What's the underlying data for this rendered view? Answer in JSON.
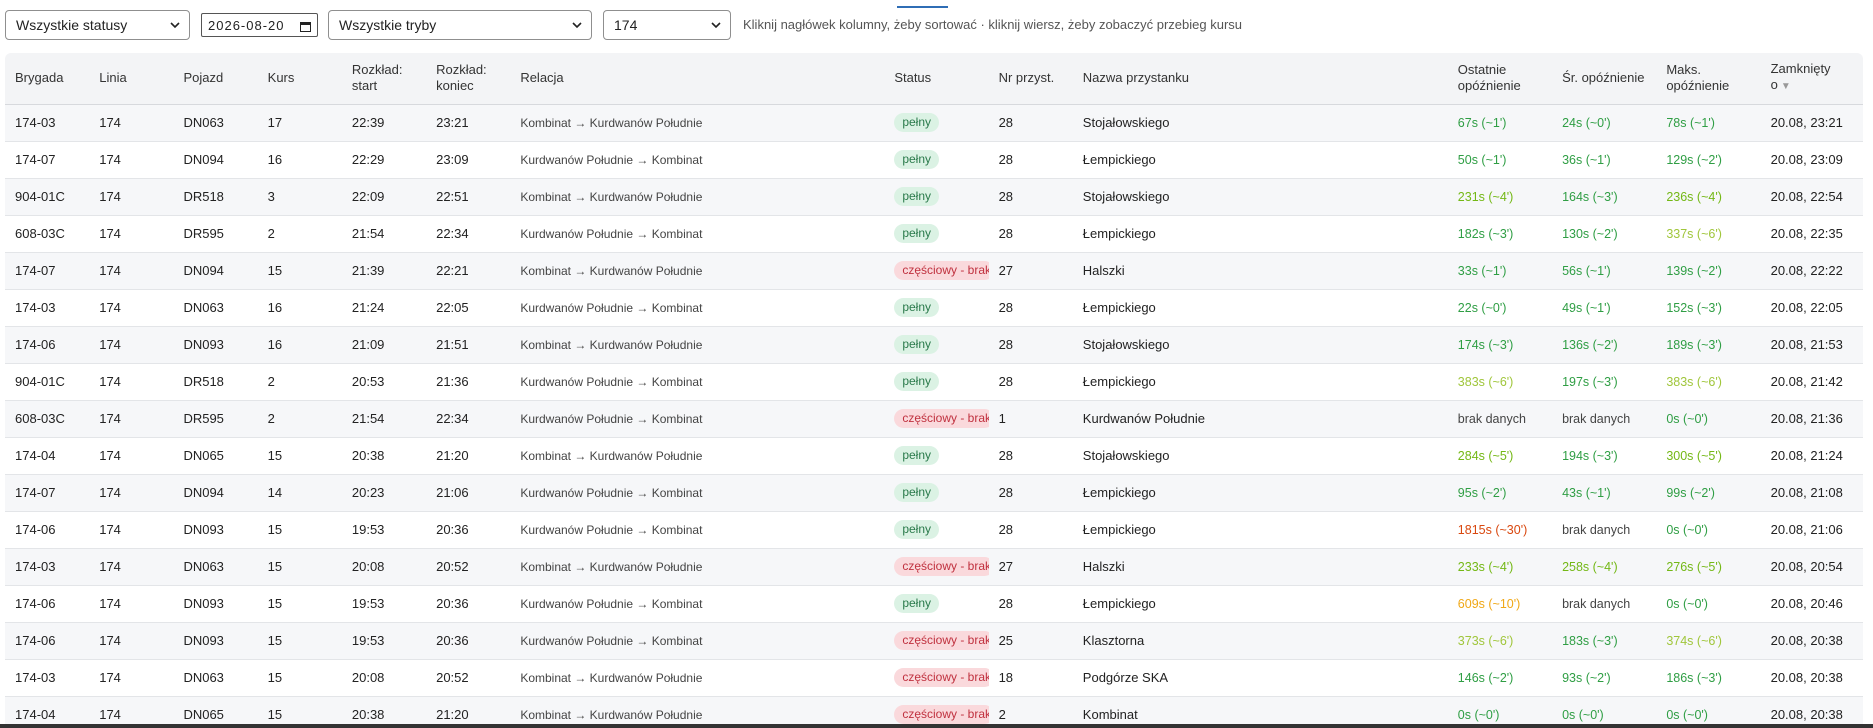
{
  "filters": {
    "status_select": "Wszystkie statusy",
    "date_input": "2026-08-20",
    "mode_select": "Wszystkie tryby",
    "line_select": "174",
    "hint": "Kliknij nagłówek kolumny, żeby sortować · kliknij wiersz, żeby zobaczyć przebieg kursu"
  },
  "table": {
    "headers": {
      "brygada": "Brygada",
      "linia": "Linia",
      "pojazd": "Pojazd",
      "kurs": "Kurs",
      "rozklad_start": [
        "Rozkład:",
        "start"
      ],
      "rozklad_koniec": [
        "Rozkład:",
        "koniec"
      ],
      "relacja": "Relacja",
      "status": "Status",
      "nr_przyst": "Nr przyst.",
      "nazwa_przystanku": "Nazwa przystanku",
      "ostatnie_opoznienie": [
        "Ostatnie",
        "opóźnienie"
      ],
      "sr_opoznienie": "Śr. opóźnienie",
      "maks_opoznienie": [
        "Maks.",
        "opóźnienie"
      ],
      "zamkniety": [
        "Zamknięty",
        "o"
      ]
    },
    "sort_indicator": "▼",
    "status_labels": {
      "full": "pełny",
      "partial": "częściowy - brak"
    },
    "colors": {
      "delay_green": "#2f9e44",
      "delay_lightgreen": "#74b816",
      "delay_yellowgreen": "#a0c63b",
      "delay_yellow": "#f0a818",
      "delay_red": "#d9480f",
      "no_data": "#444444"
    },
    "rows": [
      {
        "brygada": "174-03",
        "linia": "174",
        "pojazd": "DN063",
        "kurs": "17",
        "start": "22:39",
        "koniec": "23:21",
        "relacja": "Kombinat → Kurdwanów Południe",
        "status": "full",
        "nr": "28",
        "przystanek": "Stojałowskiego",
        "last": "67s (~1')",
        "last_c": "delay_green",
        "avg": "24s (~0')",
        "avg_c": "delay_green",
        "max": "78s (~1')",
        "max_c": "delay_green",
        "closed": "20.08, 23:21"
      },
      {
        "brygada": "174-07",
        "linia": "174",
        "pojazd": "DN094",
        "kurs": "16",
        "start": "22:29",
        "koniec": "23:09",
        "relacja": "Kurdwanów Południe → Kombinat",
        "status": "full",
        "nr": "28",
        "przystanek": "Łempickiego",
        "last": "50s (~1')",
        "last_c": "delay_green",
        "avg": "36s (~1')",
        "avg_c": "delay_green",
        "max": "129s (~2')",
        "max_c": "delay_green",
        "closed": "20.08, 23:09"
      },
      {
        "brygada": "904-01C",
        "linia": "174",
        "pojazd": "DR518",
        "kurs": "3",
        "start": "22:09",
        "koniec": "22:51",
        "relacja": "Kombinat → Kurdwanów Południe",
        "status": "full",
        "nr": "28",
        "przystanek": "Stojałowskiego",
        "last": "231s (~4')",
        "last_c": "delay_lightgreen",
        "avg": "164s (~3')",
        "avg_c": "delay_green",
        "max": "236s (~4')",
        "max_c": "delay_lightgreen",
        "closed": "20.08, 22:54"
      },
      {
        "brygada": "608-03C",
        "linia": "174",
        "pojazd": "DR595",
        "kurs": "2",
        "start": "21:54",
        "koniec": "22:34",
        "relacja": "Kurdwanów Południe → Kombinat",
        "status": "full",
        "nr": "28",
        "przystanek": "Łempickiego",
        "last": "182s (~3')",
        "last_c": "delay_green",
        "avg": "130s (~2')",
        "avg_c": "delay_green",
        "max": "337s (~6')",
        "max_c": "delay_yellowgreen",
        "closed": "20.08, 22:35"
      },
      {
        "brygada": "174-07",
        "linia": "174",
        "pojazd": "DN094",
        "kurs": "15",
        "start": "21:39",
        "koniec": "22:21",
        "relacja": "Kombinat → Kurdwanów Południe",
        "status": "partial",
        "nr": "27",
        "przystanek": "Halszki",
        "last": "33s (~1')",
        "last_c": "delay_green",
        "avg": "56s (~1')",
        "avg_c": "delay_green",
        "max": "139s (~2')",
        "max_c": "delay_green",
        "closed": "20.08, 22:22"
      },
      {
        "brygada": "174-03",
        "linia": "174",
        "pojazd": "DN063",
        "kurs": "16",
        "start": "21:24",
        "koniec": "22:05",
        "relacja": "Kurdwanów Południe → Kombinat",
        "status": "full",
        "nr": "28",
        "przystanek": "Łempickiego",
        "last": "22s (~0')",
        "last_c": "delay_green",
        "avg": "49s (~1')",
        "avg_c": "delay_green",
        "max": "152s (~3')",
        "max_c": "delay_green",
        "closed": "20.08, 22:05"
      },
      {
        "brygada": "174-06",
        "linia": "174",
        "pojazd": "DN093",
        "kurs": "16",
        "start": "21:09",
        "koniec": "21:51",
        "relacja": "Kombinat → Kurdwanów Południe",
        "status": "full",
        "nr": "28",
        "przystanek": "Stojałowskiego",
        "last": "174s (~3')",
        "last_c": "delay_green",
        "avg": "136s (~2')",
        "avg_c": "delay_green",
        "max": "189s (~3')",
        "max_c": "delay_green",
        "closed": "20.08, 21:53"
      },
      {
        "brygada": "904-01C",
        "linia": "174",
        "pojazd": "DR518",
        "kurs": "2",
        "start": "20:53",
        "koniec": "21:36",
        "relacja": "Kurdwanów Południe → Kombinat",
        "status": "full",
        "nr": "28",
        "przystanek": "Łempickiego",
        "last": "383s (~6')",
        "last_c": "delay_yellowgreen",
        "avg": "197s (~3')",
        "avg_c": "delay_green",
        "max": "383s (~6')",
        "max_c": "delay_yellowgreen",
        "closed": "20.08, 21:42"
      },
      {
        "brygada": "608-03C",
        "linia": "174",
        "pojazd": "DR595",
        "kurs": "2",
        "start": "21:54",
        "koniec": "22:34",
        "relacja": "Kurdwanów Południe → Kombinat",
        "status": "partial",
        "nr": "1",
        "przystanek": "Kurdwanów Południe",
        "last": "brak danych",
        "last_c": "no_data",
        "avg": "brak danych",
        "avg_c": "no_data",
        "max": "0s (~0')",
        "max_c": "delay_green",
        "closed": "20.08, 21:36"
      },
      {
        "brygada": "174-04",
        "linia": "174",
        "pojazd": "DN065",
        "kurs": "15",
        "start": "20:38",
        "koniec": "21:20",
        "relacja": "Kombinat → Kurdwanów Południe",
        "status": "full",
        "nr": "28",
        "przystanek": "Stojałowskiego",
        "last": "284s (~5')",
        "last_c": "delay_lightgreen",
        "avg": "194s (~3')",
        "avg_c": "delay_green",
        "max": "300s (~5')",
        "max_c": "delay_lightgreen",
        "closed": "20.08, 21:24"
      },
      {
        "brygada": "174-07",
        "linia": "174",
        "pojazd": "DN094",
        "kurs": "14",
        "start": "20:23",
        "koniec": "21:06",
        "relacja": "Kurdwanów Południe → Kombinat",
        "status": "full",
        "nr": "28",
        "przystanek": "Łempickiego",
        "last": "95s (~2')",
        "last_c": "delay_green",
        "avg": "43s (~1')",
        "avg_c": "delay_green",
        "max": "99s (~2')",
        "max_c": "delay_green",
        "closed": "20.08, 21:08"
      },
      {
        "brygada": "174-06",
        "linia": "174",
        "pojazd": "DN093",
        "kurs": "15",
        "start": "19:53",
        "koniec": "20:36",
        "relacja": "Kurdwanów Południe → Kombinat",
        "status": "full",
        "nr": "28",
        "przystanek": "Łempickiego",
        "last": "1815s (~30')",
        "last_c": "delay_red",
        "avg": "brak danych",
        "avg_c": "no_data",
        "max": "0s (~0')",
        "max_c": "delay_green",
        "closed": "20.08, 21:06"
      },
      {
        "brygada": "174-03",
        "linia": "174",
        "pojazd": "DN063",
        "kurs": "15",
        "start": "20:08",
        "koniec": "20:52",
        "relacja": "Kombinat → Kurdwanów Południe",
        "status": "partial",
        "nr": "27",
        "przystanek": "Halszki",
        "last": "233s (~4')",
        "last_c": "delay_lightgreen",
        "avg": "258s (~4')",
        "avg_c": "delay_lightgreen",
        "max": "276s (~5')",
        "max_c": "delay_lightgreen",
        "closed": "20.08, 20:54"
      },
      {
        "brygada": "174-06",
        "linia": "174",
        "pojazd": "DN093",
        "kurs": "15",
        "start": "19:53",
        "koniec": "20:36",
        "relacja": "Kurdwanów Południe → Kombinat",
        "status": "full",
        "nr": "28",
        "przystanek": "Łempickiego",
        "last": "609s (~10')",
        "last_c": "delay_yellow",
        "avg": "brak danych",
        "avg_c": "no_data",
        "max": "0s (~0')",
        "max_c": "delay_green",
        "closed": "20.08, 20:46"
      },
      {
        "brygada": "174-06",
        "linia": "174",
        "pojazd": "DN093",
        "kurs": "15",
        "start": "19:53",
        "koniec": "20:36",
        "relacja": "Kurdwanów Południe → Kombinat",
        "status": "partial",
        "nr": "25",
        "przystanek": "Klasztorna",
        "last": "373s (~6')",
        "last_c": "delay_yellowgreen",
        "avg": "183s (~3')",
        "avg_c": "delay_green",
        "max": "374s (~6')",
        "max_c": "delay_yellowgreen",
        "closed": "20.08, 20:38"
      },
      {
        "brygada": "174-03",
        "linia": "174",
        "pojazd": "DN063",
        "kurs": "15",
        "start": "20:08",
        "koniec": "20:52",
        "relacja": "Kombinat → Kurdwanów Południe",
        "status": "partial",
        "nr": "18",
        "przystanek": "Podgórze SKA",
        "last": "146s (~2')",
        "last_c": "delay_green",
        "avg": "93s (~2')",
        "avg_c": "delay_green",
        "max": "186s (~3')",
        "max_c": "delay_green",
        "closed": "20.08, 20:38"
      },
      {
        "brygada": "174-04",
        "linia": "174",
        "pojazd": "DN065",
        "kurs": "15",
        "start": "20:38",
        "koniec": "21:20",
        "relacja": "Kombinat → Kurdwanów Południe",
        "status": "partial",
        "nr": "2",
        "przystanek": "Kombinat",
        "last": "0s (~0')",
        "last_c": "delay_green",
        "avg": "0s (~0')",
        "avg_c": "delay_green",
        "max": "0s (~0')",
        "max_c": "delay_green",
        "closed": "20.08, 20:38"
      }
    ]
  }
}
